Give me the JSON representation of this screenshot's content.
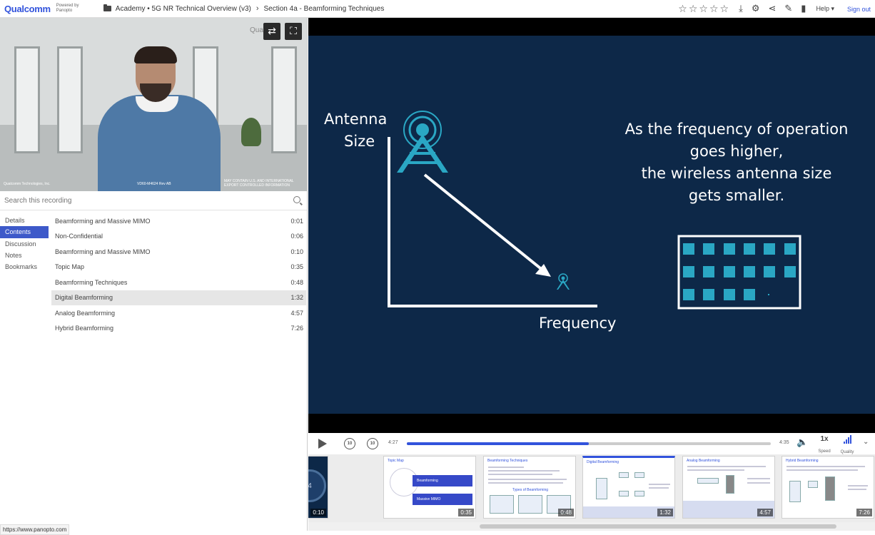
{
  "header": {
    "logo": "Qualcomm",
    "powered_by": "Powered by Panopto",
    "breadcrumb": [
      "Academy • 5G NR Technical Overview (v3)",
      "Section 4a - Beamforming Techniques"
    ],
    "help_label": "Help ▾",
    "signout_label": "Sign out",
    "rating_stars": 5,
    "icons": [
      "download-icon",
      "gear-icon",
      "share-icon",
      "pencil-icon",
      "stats-icon"
    ]
  },
  "video": {
    "watermark": "Qual",
    "caption_left": "Qualcomm Technologies, Inc.",
    "caption_mid": "VD60-M4624 Rev AB",
    "caption_right": "MAY CONTAIN U.S. AND INTERNATIONAL EXPORT CONTROLLED INFORMATION"
  },
  "search": {
    "placeholder": "Search this recording"
  },
  "sidenav": {
    "items": [
      {
        "label": "Details"
      },
      {
        "label": "Contents"
      },
      {
        "label": "Discussion"
      },
      {
        "label": "Notes"
      },
      {
        "label": "Bookmarks"
      }
    ],
    "active": "Contents"
  },
  "contents": [
    {
      "title": "Beamforming and Massive MIMO",
      "time": "0:01"
    },
    {
      "title": "Non-Confidential",
      "time": "0:06"
    },
    {
      "title": "Beamforming and Massive MIMO",
      "time": "0:10"
    },
    {
      "title": "Topic Map",
      "time": "0:35"
    },
    {
      "title": "Beamforming Techniques",
      "time": "0:48"
    },
    {
      "title": "Digital Beamforming",
      "time": "1:32"
    },
    {
      "title": "Analog Beamforming",
      "time": "4:57"
    },
    {
      "title": "Hybrid Beamforming",
      "time": "7:26"
    }
  ],
  "slide": {
    "axis_y_label_1": "Antenna",
    "axis_y_label_2": "Size",
    "axis_x_label": "Frequency",
    "message_1": "As the frequency of operation",
    "message_2": "goes higher,",
    "message_3": "the wireless antenna size",
    "message_4": "gets smaller."
  },
  "player": {
    "current_time": "4:27",
    "end_time": "4:35",
    "progress": 0.5,
    "skip_back": "10",
    "skip_fwd": "10",
    "speed_value": "1x",
    "speed_label": "Speed",
    "quality_label": "Quality"
  },
  "thumbnails": [
    {
      "title": "",
      "time": "0:10",
      "big": "4"
    },
    {
      "title": "Topic Map",
      "time": "0:35",
      "items": [
        "Beamforming",
        "Massive MIMO"
      ]
    },
    {
      "title": "Beamforming Techniques",
      "time": "0:48",
      "caption": "Types of Beamforming"
    },
    {
      "title": "Digital Beamforming",
      "time": "1:32"
    },
    {
      "title": "Analog Beamforming",
      "time": "4:57"
    },
    {
      "title": "Hybrid Beamforming",
      "time": "7:26"
    }
  ],
  "status_url": "https://www.panopto.com",
  "colors": {
    "accent": "#3253dc",
    "slide_bg": "#0d2848",
    "slide_accent": "#2aa7c4"
  }
}
